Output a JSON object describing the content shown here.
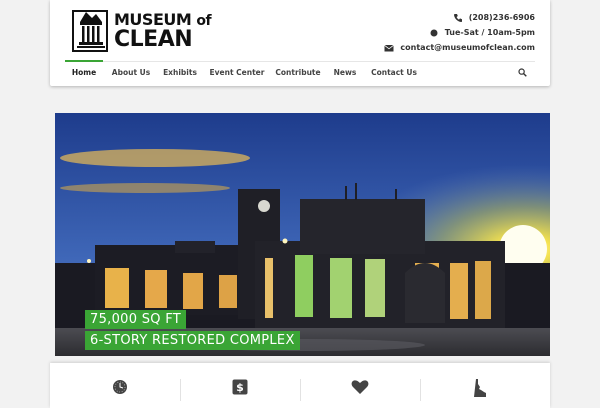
{
  "brand": {
    "line1": "MUSEUM",
    "line1_suffix": "of",
    "line2": "CLEAN"
  },
  "contact": {
    "phone": "(208)236-6906",
    "hours": "Tue-Sat / 10am-5pm",
    "email": "contact@museumofclean.com"
  },
  "nav": {
    "items": [
      {
        "label": "Home",
        "active": true
      },
      {
        "label": "About Us"
      },
      {
        "label": "Exhibits"
      },
      {
        "label": "Event Center"
      },
      {
        "label": "Contribute"
      },
      {
        "label": "News"
      },
      {
        "label": "Contact Us"
      }
    ],
    "search_icon": "search-icon"
  },
  "hero": {
    "caption1": "75,000 SQ FT",
    "caption2": "6-STORY RESTORED COMPLEX"
  },
  "features": {
    "icons": [
      "clock-icon",
      "dollar-icon",
      "heart-icon",
      "idaho-state-icon"
    ]
  },
  "colors": {
    "accent": "#3aa535",
    "header_bg": "#ffffff",
    "page_bg": "#f2f2f2"
  }
}
